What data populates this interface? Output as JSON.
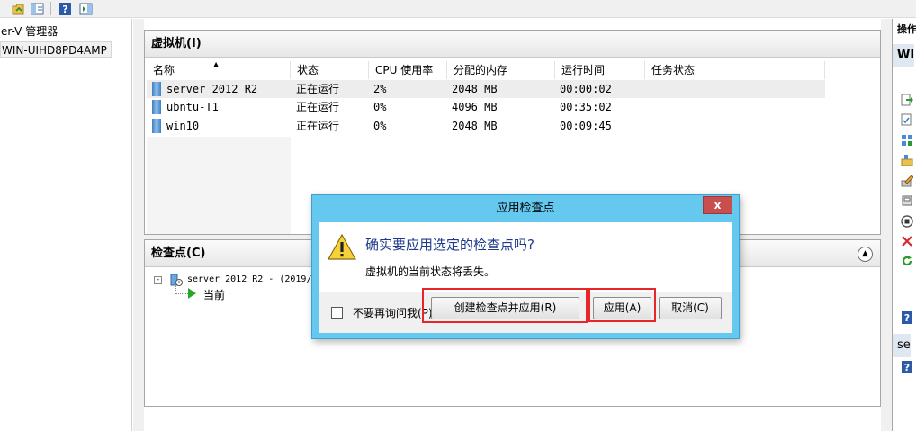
{
  "tree": {
    "root_label": "er-V 管理器",
    "host_label": "WIN-UIHD8PD4AMP"
  },
  "vm_panel": {
    "title": "虚拟机(I)",
    "columns": [
      "名称",
      "状态",
      "CPU 使用率",
      "分配的内存",
      "运行时间",
      "任务状态"
    ],
    "rows": [
      {
        "name": "server 2012 R2",
        "state": "正在运行",
        "cpu": "2%",
        "memory": "2048 MB",
        "uptime": "00:00:02",
        "task": ""
      },
      {
        "name": "ubntu-T1",
        "state": "正在运行",
        "cpu": "0%",
        "memory": "4096 MB",
        "uptime": "00:35:02",
        "task": ""
      },
      {
        "name": "win10",
        "state": "正在运行",
        "cpu": "0%",
        "memory": "2048 MB",
        "uptime": "00:09:45",
        "task": ""
      }
    ]
  },
  "checkpoint_panel": {
    "title": "检查点(C)",
    "root_item": "server 2012 R2 - (2019/",
    "child_item": "当前"
  },
  "actions": {
    "title": "操作",
    "section1": "WI",
    "section2": "se"
  },
  "dialog": {
    "title": "应用检查点",
    "close": "x",
    "message": "确实要应用选定的检查点吗?",
    "detail": "虚拟机的当前状态将丢失。",
    "checkbox_label": "不要再询问我(P)",
    "btn_create": "创建检查点并应用(R)",
    "btn_apply": "应用(A)",
    "btn_cancel": "取消(C)"
  },
  "colors": {
    "dialog_frame": "#64c8ef",
    "highlight_box": "#e8262a",
    "message_text": "#1e3a8c"
  }
}
